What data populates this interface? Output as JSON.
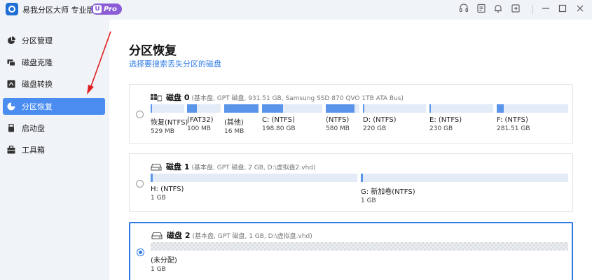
{
  "app": {
    "title": "易我分区大师 专业版",
    "badge_letter": "U",
    "badge_text": "Pro",
    "accent": "#2f7be6",
    "badge_color": "#8a5cd6"
  },
  "titlebar_icons": [
    "headset-icon",
    "feedback-icon",
    "bell-icon",
    "login-icon",
    "minimize-icon",
    "maximize-icon",
    "close-icon"
  ],
  "sidebar": {
    "items": [
      {
        "label": "分区管理",
        "icon": "pie-chart-icon",
        "active": false
      },
      {
        "label": "磁盘克隆",
        "icon": "disk-clone-icon",
        "active": false
      },
      {
        "label": "磁盘转换",
        "icon": "disk-convert-icon",
        "active": false
      },
      {
        "label": "分区恢复",
        "icon": "partition-recovery-icon",
        "active": true
      },
      {
        "label": "启动盘",
        "icon": "usb-icon",
        "active": false
      },
      {
        "label": "工具箱",
        "icon": "toolbox-icon",
        "active": false
      }
    ]
  },
  "main": {
    "title": "分区恢复",
    "subtitle": "选择要搜索丢失分区的磁盘"
  },
  "disks": [
    {
      "name": "磁盘 0",
      "info": "(基本盘, GPT 磁盘, 931.51 GB, Samsung SSD 870 QVO 1TB ATA Bus)",
      "selected": false,
      "partitions": [
        {
          "name": "恢复(NTFS)",
          "size": "529 MB",
          "used": 0.0
        },
        {
          "name": "(FAT32)",
          "size": "100 MB",
          "used": 0.3
        },
        {
          "name": "(其他)",
          "size": "16 MB",
          "used": 1.0
        },
        {
          "name": "C: (NTFS)",
          "size": "198.80 GB",
          "used": 0.35
        },
        {
          "name": "(NTFS)",
          "size": "580 MB",
          "used": 0.85
        },
        {
          "name": "D: (NTFS)",
          "size": "220 GB",
          "used": 0.0
        },
        {
          "name": "E: (NTFS)",
          "size": "230 GB",
          "used": 0.0
        },
        {
          "name": "F: (NTFS)",
          "size": "281.51 GB",
          "used": 0.1
        }
      ]
    },
    {
      "name": "磁盘 1",
      "info": "(基本盘, GPT 磁盘, 2 GB, D:\\虚拟盘2.vhd)",
      "selected": false,
      "partitions": [
        {
          "name": "H: (NTFS)",
          "size": "1 GB",
          "used": 0.01
        },
        {
          "name": "G: 新加卷(NTFS)",
          "size": "1 GB",
          "used": 0.01
        }
      ]
    },
    {
      "name": "磁盘 2",
      "info": "(基本盘, GPT 磁盘, 1 GB, D:\\虚拟盘.vhd)",
      "selected": true,
      "partitions": [
        {
          "name": "(未分配)",
          "size": "1 GB",
          "used": 0.0
        }
      ]
    }
  ]
}
